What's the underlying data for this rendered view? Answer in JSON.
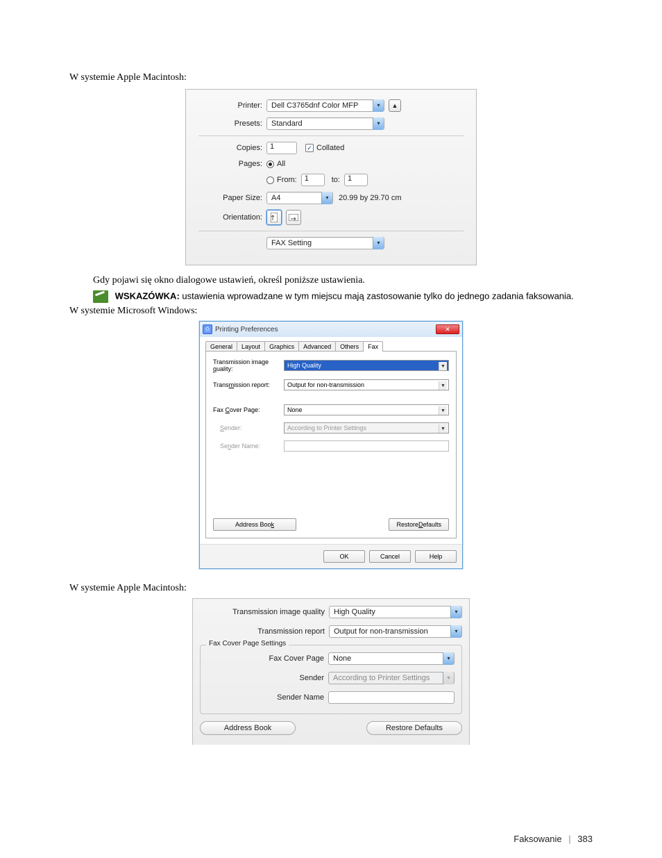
{
  "narrative": {
    "mac_heading": "W systemie Apple Macintosh:",
    "after_mac": "Gdy pojawi się okno dialogowe ustawień, określ poniższe ustawienia.",
    "tip_label": "WSKAZÓWKA:",
    "tip_text": "ustawienia wprowadzane w tym miejscu mają zastosowanie tylko do jednego zadania faksowania.",
    "win_heading": "W systemie Microsoft Windows:",
    "mac_heading2": "W systemie Apple Macintosh:"
  },
  "mac_print": {
    "printer_label": "Printer:",
    "printer_value": "Dell C3765dnf Color MFP",
    "presets_label": "Presets:",
    "presets_value": "Standard",
    "copies_label": "Copies:",
    "copies_value": "1",
    "collated_label": "Collated",
    "pages_label": "Pages:",
    "pages_all": "All",
    "pages_from": "From:",
    "pages_from_val": "1",
    "pages_to": "to:",
    "pages_to_val": "1",
    "papersize_label": "Paper Size:",
    "papersize_value": "A4",
    "papersize_dim": "20.99 by 29.70 cm",
    "orientation_label": "Orientation:",
    "section_value": "FAX Setting"
  },
  "win_dlg": {
    "title": "Printing Preferences",
    "tabs": {
      "general": "General",
      "layout": "Layout",
      "graphics": "Graphics",
      "advanced": "Advanced",
      "others": "Others",
      "fax": "Fax"
    },
    "tiq_label_pre": "Transmission image ",
    "tiq_label_u": "q",
    "tiq_label_post": "uality:",
    "tiq_value": "High Quality",
    "trr_label_pre": "Trans",
    "trr_label_u": "m",
    "trr_label_post": "ission report:",
    "trr_value": "Output for non-transmission",
    "fcp_label_pre": "Fax ",
    "fcp_label_u": "C",
    "fcp_label_post": "over Page:",
    "fcp_value": "None",
    "sender_label_u": "S",
    "sender_label_post": "ender:",
    "sender_value": "According to Printer Settings",
    "sendername_label_pre": "Se",
    "sendername_label_u": "n",
    "sendername_label_post": "der Name:",
    "addressbook_pre": "Address Boo",
    "addressbook_u": "k",
    "restore_pre": "Restore ",
    "restore_u": "D",
    "restore_post": "efaults",
    "ok": "OK",
    "cancel": "Cancel",
    "help": "Help"
  },
  "mac_fax": {
    "tiq_label": "Transmission image quality",
    "tiq_value": "High Quality",
    "trr_label": "Transmission report",
    "trr_value": "Output for non-transmission",
    "group_label": "Fax Cover Page Settings",
    "fcp_label": "Fax Cover Page",
    "fcp_value": "None",
    "sender_label": "Sender",
    "sender_value": "According to Printer Settings",
    "sendername_label": "Sender Name",
    "addressbook": "Address Book",
    "restore": "Restore Defaults"
  },
  "footer": {
    "section": "Faksowanie",
    "page": "383"
  }
}
